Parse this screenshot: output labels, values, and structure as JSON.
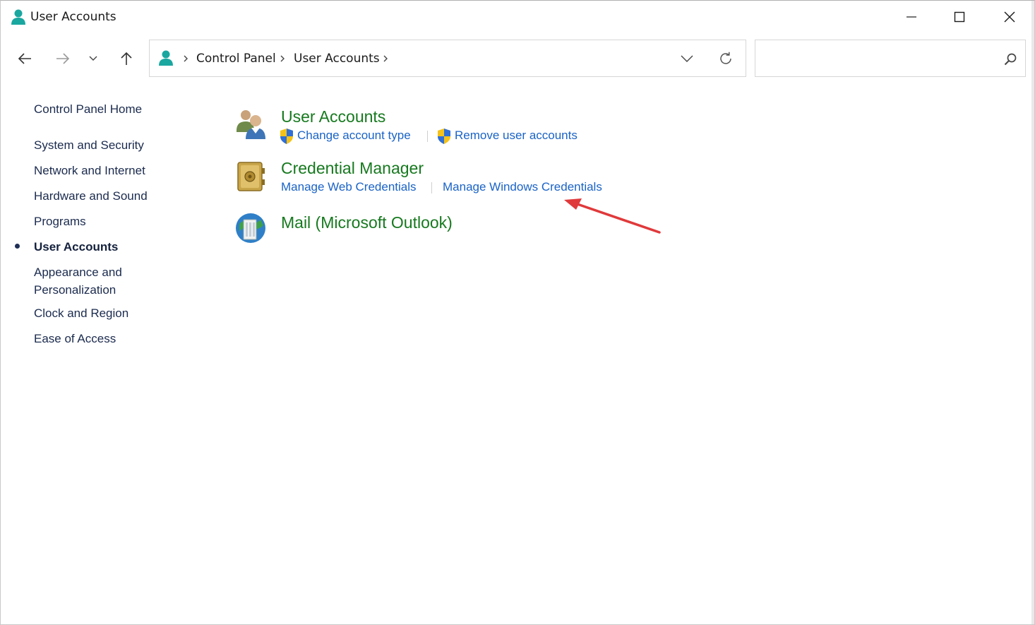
{
  "window": {
    "title": "User Accounts",
    "icon": "user-accounts-icon"
  },
  "titlebar": {
    "minimize_icon": "minimize-icon",
    "maximize_icon": "maximize-icon",
    "close_icon": "close-icon"
  },
  "address_bar": {
    "crumbs": [
      "Control Panel",
      "User Accounts"
    ],
    "dropdown_icon": "chevron-down-icon",
    "refresh_icon": "refresh-icon"
  },
  "search": {
    "value": "",
    "icon": "search-icon"
  },
  "sidebar": {
    "items": [
      {
        "label": "Control Panel Home",
        "active": false
      },
      {
        "label": "System and Security",
        "active": false
      },
      {
        "label": "Network and Internet",
        "active": false
      },
      {
        "label": "Hardware and Sound",
        "active": false
      },
      {
        "label": "Programs",
        "active": false
      },
      {
        "label": "User Accounts",
        "active": true
      },
      {
        "label": "Appearance and Personalization",
        "active": false
      },
      {
        "label": "Clock and Region",
        "active": false
      },
      {
        "label": "Ease of Access",
        "active": false
      }
    ]
  },
  "categories": [
    {
      "title": "User Accounts",
      "icon": "users-icon",
      "links": [
        {
          "label": "Change account type",
          "shield": true
        },
        {
          "label": "Remove user accounts",
          "shield": true
        }
      ]
    },
    {
      "title": "Credential Manager",
      "icon": "vault-icon",
      "links": [
        {
          "label": "Manage Web Credentials",
          "shield": false
        },
        {
          "label": "Manage Windows Credentials",
          "shield": false
        }
      ]
    },
    {
      "title": "Mail (Microsoft Outlook)",
      "icon": "mail-globe-icon",
      "links": []
    }
  ],
  "annotation": {
    "icon": "red-arrow-icon",
    "color": "#e0393b"
  },
  "colors": {
    "category_title": "#16791e",
    "link": "#1a63c6",
    "sidebar_text": "#1b2b4e"
  }
}
